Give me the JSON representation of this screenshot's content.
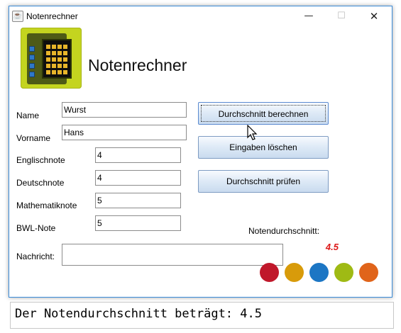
{
  "window": {
    "title": "Notenrechner",
    "icon": "java-icon",
    "controls": {
      "minimize": "—",
      "maximize": "☐",
      "close": "✕"
    }
  },
  "app": {
    "heading": "Notenrechner",
    "logo": "calculator-icon",
    "logo_color": "#c4d41f"
  },
  "form": {
    "name": {
      "label": "Name",
      "value": "Wurst"
    },
    "vorname": {
      "label": "Vorname",
      "value": "Hans"
    },
    "englisch": {
      "label": "Englischnote",
      "value": "4"
    },
    "deutsch": {
      "label": "Deutschnote",
      "value": "4"
    },
    "mathe": {
      "label": "Mathematiknote",
      "value": "5"
    },
    "bwl": {
      "label": "BWL-Note",
      "value": "5"
    },
    "nachricht": {
      "label": "Nachricht:",
      "value": ""
    }
  },
  "buttons": {
    "calculate": "Durchschnitt berechnen",
    "clear": "Eingaben löschen",
    "check": "Durchschnitt prüfen"
  },
  "result": {
    "label": "Notendurchschnitt:",
    "value": "4.5",
    "value_color": "#dd1a1a"
  },
  "color_dots": [
    "#c0182b",
    "#d89b0a",
    "#1c76c4",
    "#9fba14",
    "#e0641a"
  ],
  "console": {
    "text": "Der Notendurchschnitt beträgt: 4.5"
  }
}
